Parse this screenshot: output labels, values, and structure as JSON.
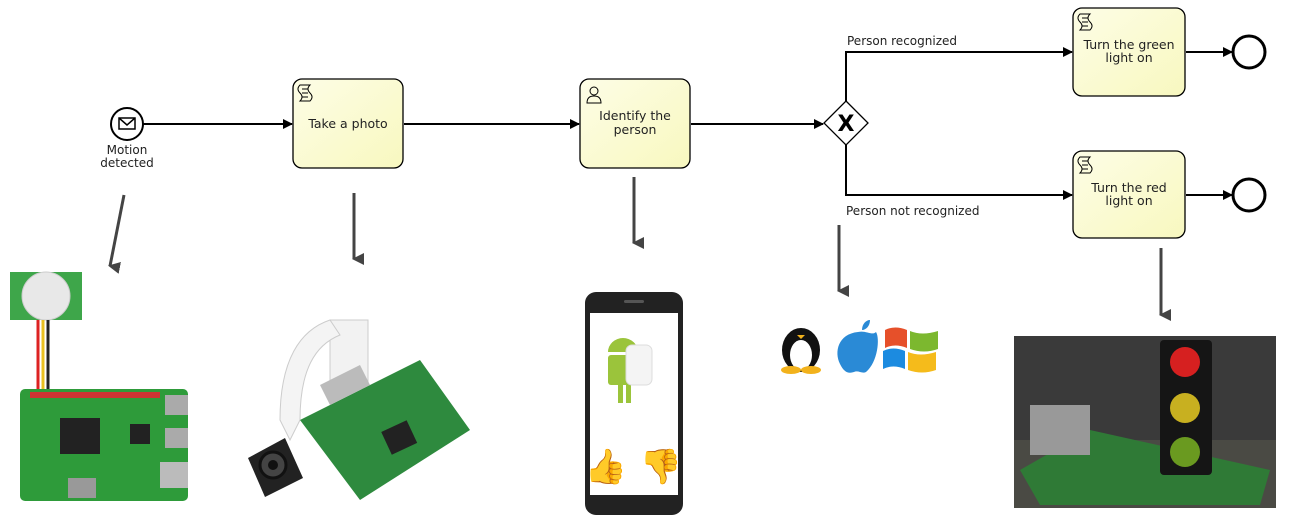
{
  "process": {
    "start_event": {
      "label_line1": "Motion",
      "label_line2": "detected",
      "icon": "envelope-icon"
    },
    "tasks": [
      {
        "type": "script",
        "icon": "script-icon",
        "line1": "Take a photo",
        "line2": ""
      },
      {
        "type": "user",
        "icon": "user-icon",
        "line1": "Identify the",
        "line2": "person"
      },
      {
        "type": "script",
        "icon": "script-icon",
        "line1": "Turn the green",
        "line2": "light on"
      },
      {
        "type": "script",
        "icon": "script-icon",
        "line1": "Turn the red",
        "line2": "light on"
      }
    ],
    "gateway": {
      "type": "exclusive",
      "marker": "X"
    },
    "flows": {
      "recognized": "Person recognized",
      "not_recognized": "Person not recognized"
    }
  },
  "colors": {
    "task_fill": "#fbfbd4",
    "stroke": "#000000",
    "pointer_arrow": "#444444",
    "pi_green": "#2e9b3a"
  }
}
